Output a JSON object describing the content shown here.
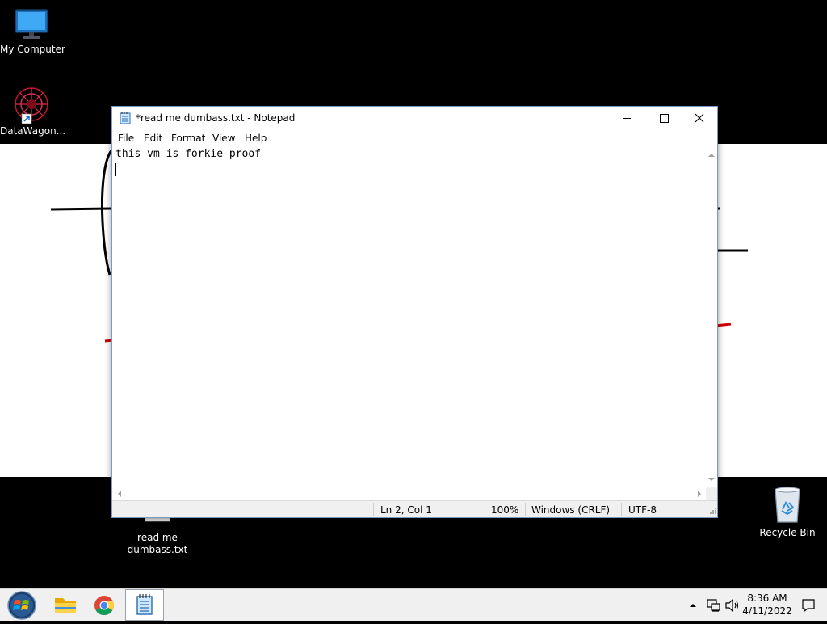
{
  "desktop": {
    "icons": [
      {
        "label": "My Computer",
        "icon": "monitor-icon"
      },
      {
        "label": "DataWagon...",
        "icon": "datawagon-shortcut-icon"
      },
      {
        "label": "read me dumbass.txt",
        "label_line1": "read me",
        "label_line2": "dumbass.txt",
        "icon": "text-file-icon"
      },
      {
        "label": "Recycle Bin",
        "icon": "recycle-bin-icon"
      }
    ]
  },
  "notepad": {
    "title": "*read me dumbass.txt - Notepad",
    "menu": [
      "File",
      "Edit",
      "Format",
      "View",
      "Help"
    ],
    "content_line1": "this vm is forkie-proof",
    "content_line2": "",
    "status": {
      "position": "Ln 2, Col 1",
      "zoom": "100%",
      "line_endings": "Windows (CRLF)",
      "encoding": "UTF-8"
    }
  },
  "taskbar": {
    "buttons": [
      "start-orb-icon",
      "file-explorer-icon",
      "chrome-icon",
      "notepad-icon"
    ],
    "tray_icons": [
      "show-hidden-icons-chevron",
      "network-icon",
      "volume-icon"
    ],
    "clock_time": "8:36 AM",
    "clock_date": "4/11/2022"
  },
  "colors": {
    "desktop_bg": "#000000",
    "window_border": "#7a9ac4",
    "taskbar_bg": "#f0f0f0",
    "drawing_red": "#d40000"
  }
}
